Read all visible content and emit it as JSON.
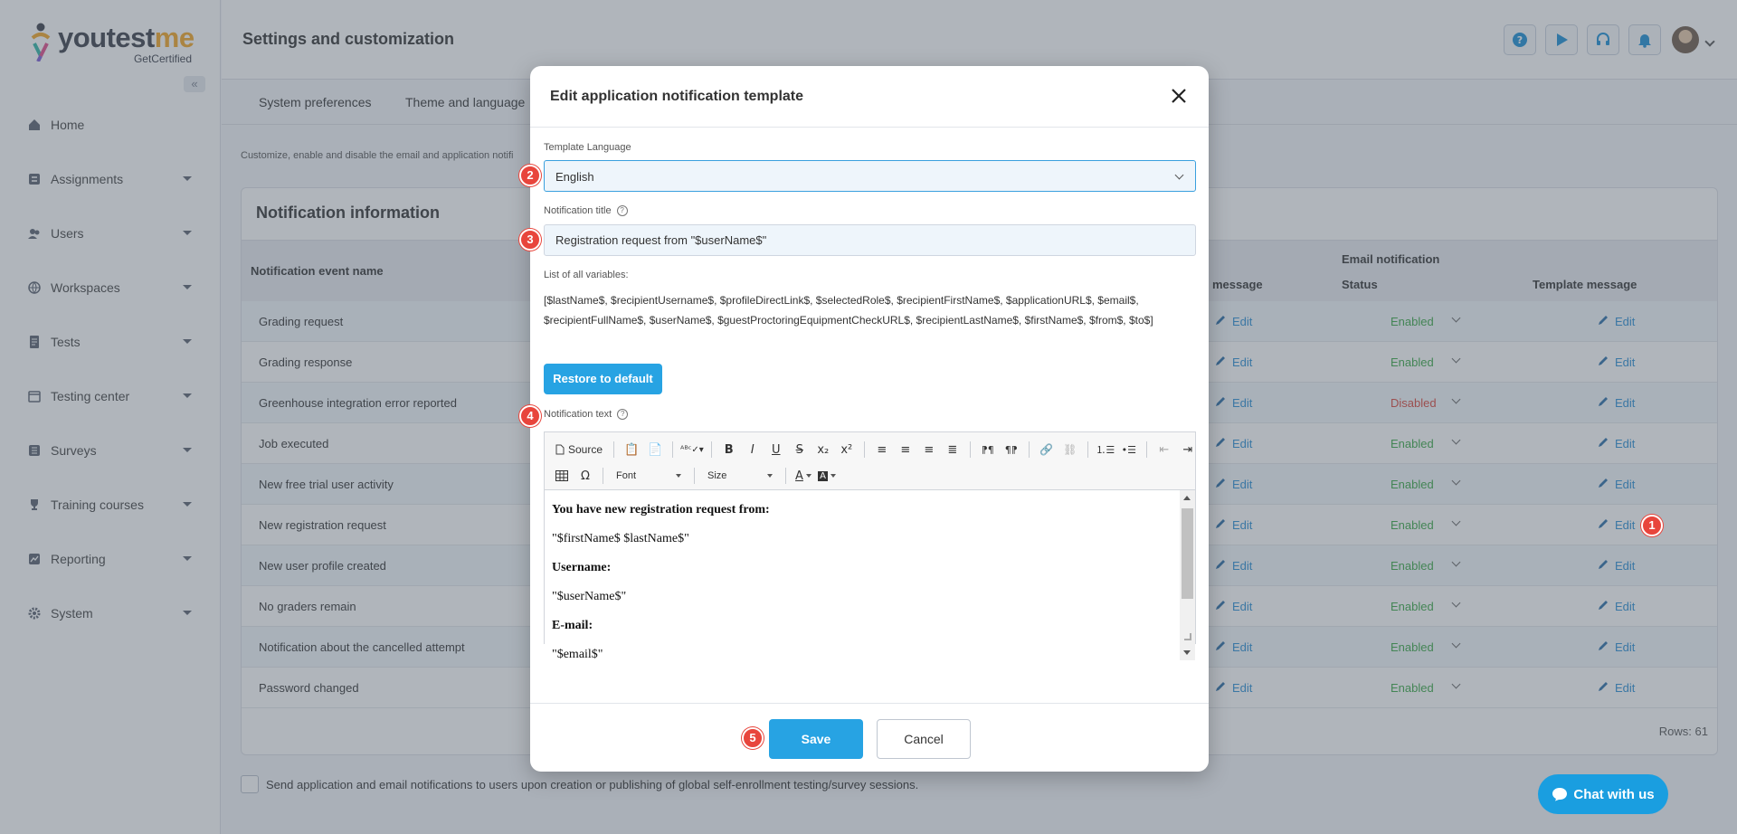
{
  "app": {
    "logo_main_a": "youtest",
    "logo_main_b": "me",
    "logo_sub": "GetCertified",
    "collapse_glyph": "«"
  },
  "sidebar": {
    "items": [
      {
        "label": "Home",
        "icon": "home-icon",
        "has_caret": false
      },
      {
        "label": "Assignments",
        "icon": "assignments-icon",
        "has_caret": true
      },
      {
        "label": "Users",
        "icon": "users-icon",
        "has_caret": true
      },
      {
        "label": "Workspaces",
        "icon": "globe-icon",
        "has_caret": true
      },
      {
        "label": "Tests",
        "icon": "tests-icon",
        "has_caret": true
      },
      {
        "label": "Testing center",
        "icon": "calendar-icon",
        "has_caret": true
      },
      {
        "label": "Surveys",
        "icon": "surveys-icon",
        "has_caret": true
      },
      {
        "label": "Training courses",
        "icon": "trophy-icon",
        "has_caret": true
      },
      {
        "label": "Reporting",
        "icon": "chart-icon",
        "has_caret": true
      },
      {
        "label": "System",
        "icon": "gear-icon",
        "has_caret": true
      }
    ]
  },
  "header": {
    "title": "Settings and customization",
    "icons": [
      "help-icon",
      "play-icon",
      "headset-icon",
      "bell-icon"
    ]
  },
  "tabs": [
    "System preferences",
    "Theme and language"
  ],
  "description": "Customize, enable and disable the email and application notifi",
  "card": {
    "title": "Notification information",
    "columns": {
      "event": "Notification event name",
      "app_message": "message",
      "email_group": "Email notification",
      "status": "Status",
      "template": "Template message"
    },
    "edit_label": "Edit",
    "rows": [
      {
        "name": "Grading request",
        "status": "Enabled"
      },
      {
        "name": "Grading response",
        "status": "Enabled"
      },
      {
        "name": "Greenhouse integration error reported",
        "status": "Disabled"
      },
      {
        "name": "Job executed",
        "status": "Enabled"
      },
      {
        "name": "New free trial user activity",
        "status": "Enabled"
      },
      {
        "name": "New registration request",
        "status": "Enabled"
      },
      {
        "name": "New user profile created",
        "status": "Enabled"
      },
      {
        "name": "No graders remain",
        "status": "Enabled"
      },
      {
        "name": "Notification about the cancelled attempt",
        "status": "Enabled"
      },
      {
        "name": "Password changed",
        "status": "Enabled"
      }
    ],
    "rows_count": "Rows: 61"
  },
  "bottom_checkbox_label": "Send application and email notifications to users upon creation or publishing of global self-enrollment testing/survey sessions.",
  "chat": {
    "label": "Chat with us"
  },
  "modal": {
    "title": "Edit application notification template",
    "template_language_label": "Template Language",
    "template_language_value": "English",
    "notification_title_label": "Notification title",
    "notification_title_value": "Registration request from \"$userName$\"",
    "variables_label": "List of all variables:",
    "variables_text": "[$lastName$, $recipientUsername$, $profileDirectLink$, $selectedRole$, $recipientFirstName$, $applicationURL$, $email$, $recipientFullName$, $userName$, $guestProctoringEquipmentCheckURL$, $recipientLastName$, $firstName$, $from$, $to$]",
    "restore_label": "Restore to default",
    "notification_text_label": "Notification text",
    "toolbar": {
      "source_label": "Source",
      "font_label": "Font",
      "size_label": "Size"
    },
    "editor_lines": [
      {
        "text": "You have new registration request from:",
        "bold": true
      },
      {
        "text": "\"$firstName$ $lastName$\"",
        "bold": false
      },
      {
        "text": "Username:",
        "bold": true
      },
      {
        "text": "\"$userName$\"",
        "bold": false
      },
      {
        "text": "E-mail:",
        "bold": true
      },
      {
        "text": "\"$email$\"",
        "bold": false
      }
    ],
    "save_label": "Save",
    "cancel_label": "Cancel"
  },
  "steps": [
    "1",
    "2",
    "3",
    "4",
    "5"
  ],
  "colors": {
    "accent": "#27a3e3",
    "enabled": "#3aa845",
    "disabled": "#d9463b",
    "step_marker": "#e8453c"
  }
}
